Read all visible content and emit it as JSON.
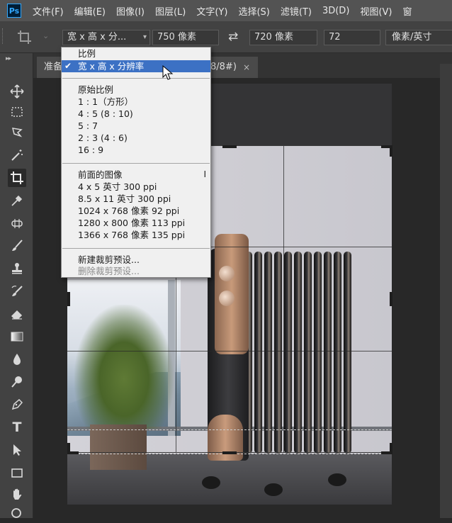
{
  "menubar": {
    "logo": "Ps",
    "items": [
      "文件(F)",
      "编辑(E)",
      "图像(I)",
      "图层(L)",
      "文字(Y)",
      "选择(S)",
      "滤镜(T)",
      "3D(D)",
      "视图(V)",
      "窗"
    ]
  },
  "options": {
    "ratio_preset": "宽 x 高 x 分...",
    "width": "750 像素",
    "height": "720 像素",
    "resolution": "72",
    "resolution_unit": "像素/英寸"
  },
  "document": {
    "tab_prefix": "准备",
    "tab_suffix": "8/8#)",
    "tab_close": "×"
  },
  "dropdown": {
    "header_ratio": "比例",
    "selected": "宽 x 高 x 分辨率",
    "section_original": "原始比例",
    "ratios": [
      "1 : 1（方形）",
      "4 : 5 (8 : 10)",
      "5 : 7",
      "2 : 3 (4 : 6)",
      "16 : 9"
    ],
    "section_front": "前面的图像",
    "front_shortcut": "I",
    "sizes": [
      "4 x 5 英寸 300 ppi",
      "8.5 x 11 英寸 300 ppi",
      "1024 x 768 像素 92 ppi",
      "1280 x 800 像素 113 ppi",
      "1366 x 768 像素 135 ppi"
    ],
    "new_preset": "新建裁剪预设...",
    "delete_preset": "删除裁剪预设..."
  },
  "tools": [
    "move-icon",
    "marquee-icon",
    "lasso-icon",
    "magic-wand-icon",
    "crop-icon",
    "eyedropper-icon",
    "healing-icon",
    "brush-icon",
    "stamp-icon",
    "history-brush-icon",
    "eraser-icon",
    "gradient-icon",
    "blur-icon",
    "dodge-icon",
    "pen-icon",
    "type-icon",
    "path-select-icon",
    "rectangle-icon",
    "hand-icon",
    "zoom-icon"
  ],
  "colors": {
    "menu_bg": "#535353",
    "panel_bg": "#424242",
    "selection": "#3c71c4"
  }
}
